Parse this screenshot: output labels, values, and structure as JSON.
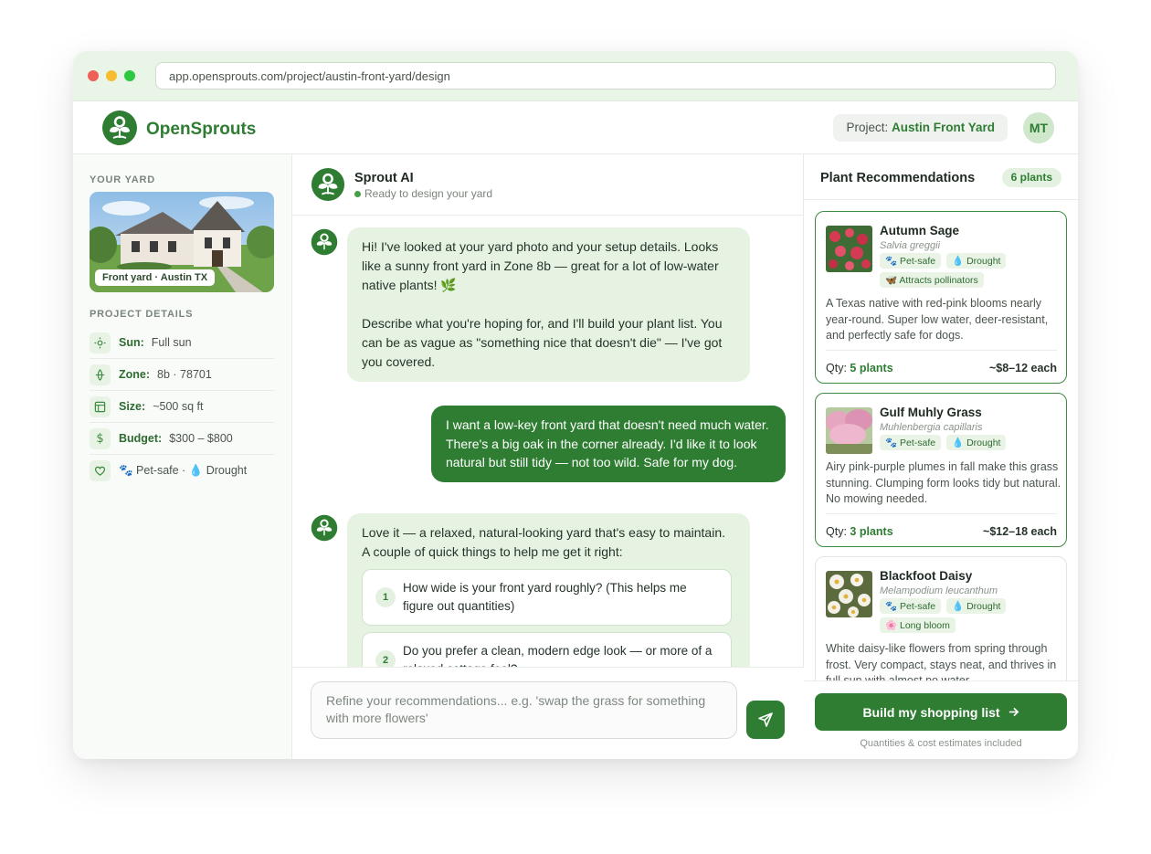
{
  "browser": {
    "url": "app.opensprouts.com/project/austin-front-yard/design"
  },
  "header": {
    "brand": "OpenSprouts",
    "project_label": "Project:",
    "project_name": "Austin Front Yard",
    "avatar_initials": "MT"
  },
  "sidebar": {
    "yard_heading": "YOUR YARD",
    "photo_caption": "Front yard · Austin TX",
    "details_heading": "PROJECT DETAILS",
    "details": [
      {
        "icon": "sun-icon",
        "label": "Sun:",
        "value": "Full sun"
      },
      {
        "icon": "zone-icon",
        "label": "Zone:",
        "value": "8b · 78701"
      },
      {
        "icon": "size-icon",
        "label": "Size:",
        "value": "~500 sq ft"
      },
      {
        "icon": "dollar-icon",
        "label": "Budget:",
        "value": "$300 – $800"
      },
      {
        "icon": "heart-icon",
        "label": "",
        "value": "🐾 Pet-safe · 💧 Drought"
      }
    ]
  },
  "chat": {
    "bot_name": "Sprout AI",
    "bot_status": "Ready to design your yard",
    "messages": [
      {
        "role": "bot",
        "p1": "Hi! I've looked at your yard photo and your setup details. Looks like a sunny front yard in Zone 8b — great for a lot of low-water native plants! 🌿",
        "p2": "Describe what you're hoping for, and I'll build your plant list. You can be as vague as \"something nice that doesn't die\" — I've got you covered."
      },
      {
        "role": "user",
        "text": "I want a low-key front yard that doesn't need much water. There's a big oak in the corner already. I'd like it to look natural but still tidy — not too wild. Safe for my dog."
      },
      {
        "role": "bot",
        "p1": "Love it — a relaxed, natural-looking yard that's easy to maintain. A couple of quick things to help me get it right:",
        "questions": [
          {
            "num": "1",
            "text": "How wide is your front yard roughly? (This helps me figure out quantities)"
          },
          {
            "num": "2",
            "text": "Do you prefer a clean, modern edge look — or more of a relaxed cottage feel?"
          }
        ]
      }
    ],
    "composer_placeholder": "Refine your recommendations... e.g. 'swap the grass for something with more flowers'"
  },
  "recommendations": {
    "title": "Plant Recommendations",
    "count": "6 plants",
    "plants": [
      {
        "name": "Autumn Sage",
        "latin": "Salvia greggii",
        "tags": [
          "🐾 Pet-safe",
          "💧 Drought",
          "🦋 Attracts pollinators"
        ],
        "description": "A Texas native with red-pink blooms nearly year-round. Super low water, deer-resistant, and perfectly safe for dogs.",
        "qty_label": "Qty:",
        "qty": "5 plants",
        "price": "~$8–12 each",
        "thumb_color": "#c8304a"
      },
      {
        "name": "Gulf Muhly Grass",
        "latin": "Muhlenbergia capillaris",
        "tags": [
          "🐾 Pet-safe",
          "💧 Drought"
        ],
        "description": "Airy pink-purple plumes in fall make this grass stunning. Clumping form looks tidy but natural. No mowing needed.",
        "qty_label": "Qty:",
        "qty": "3 plants",
        "price": "~$12–18 each",
        "thumb_color": "#e7a6c0"
      },
      {
        "name": "Blackfoot Daisy",
        "latin": "Melampodium leucanthum",
        "tags": [
          "🐾 Pet-safe",
          "💧 Drought",
          "🌸 Long bloom"
        ],
        "description": "White daisy-like flowers from spring through frost. Very compact, stays neat, and thrives in full sun with almost no water.",
        "thumb_color": "#f4f1e8"
      }
    ],
    "build_button": "Build my shopping list",
    "footer_note": "Quantities & cost estimates included"
  },
  "colors": {
    "brand_green": "#2e7d32",
    "bot_bubble": "#e6f3e3",
    "titlebar": "#e9f5e6"
  }
}
